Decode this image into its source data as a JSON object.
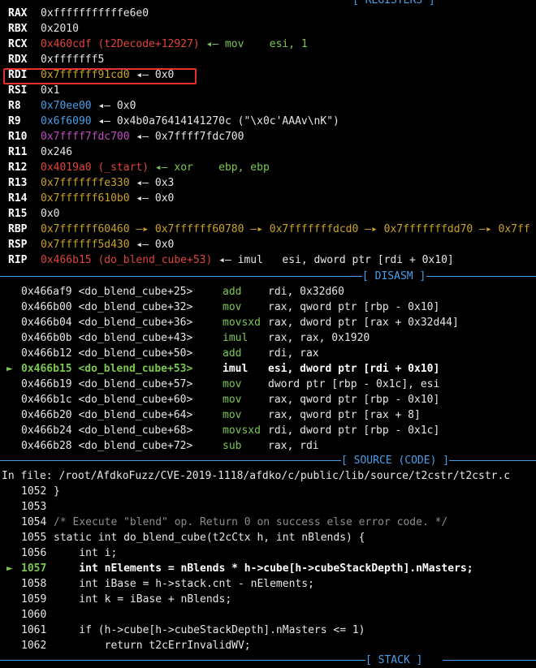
{
  "top_label": "[ REGISTERS ]",
  "registers": [
    {
      "name": "RAX",
      "value": "0xfffffffffffe6e0",
      "color": "w",
      "rest": ""
    },
    {
      "name": "RBX",
      "value": "0x2010",
      "color": "w",
      "rest": ""
    },
    {
      "name": "RCX",
      "value": "0x460cdf (t2Decode+12927)",
      "color": "red",
      "rest": " ◂— mov    esi, 1",
      "rest_color": "grn"
    },
    {
      "name": "RDX",
      "value": "0xfffffff5",
      "color": "w",
      "rest": ""
    },
    {
      "name": "RDI",
      "value": "0x7ffffff91cd0",
      "color": "yel",
      "rest": " ◂— 0x0",
      "rest_color": "w"
    },
    {
      "name": "RSI",
      "value": "0x1",
      "color": "w",
      "rest": ""
    },
    {
      "name": "R8",
      "value": "0x70ee00",
      "color": "blue",
      "rest": " ◂— 0x0",
      "rest_color": "w"
    },
    {
      "name": "R9",
      "value": "0x6f6090",
      "color": "blue",
      "rest": " ◂— 0x4b0a76414141270c (\"\\x0c'AAAv\\nK\")",
      "rest_color": "w"
    },
    {
      "name": "R10",
      "value": "0x7ffff7fdc700",
      "color": "mag",
      "rest": " ◂— 0x7ffff7fdc700",
      "rest_color": "w"
    },
    {
      "name": "R11",
      "value": "0x246",
      "color": "w",
      "rest": ""
    },
    {
      "name": "R12",
      "value": "0x4019a0 (_start)",
      "color": "red",
      "rest": " ◂— xor    ebp, ebp",
      "rest_color": "grn"
    },
    {
      "name": "R13",
      "value": "0x7fffffffe330",
      "color": "yel",
      "rest": " ◂— 0x3",
      "rest_color": "w"
    },
    {
      "name": "R14",
      "value": "0x7ffffff610b0",
      "color": "yel",
      "rest": " ◂— 0x0",
      "rest_color": "w"
    },
    {
      "name": "R15",
      "value": "0x0",
      "color": "w",
      "rest": ""
    },
    {
      "name": "RBP",
      "value": "0x7ffffff60460",
      "color": "yel",
      "rest": " —▸ 0x7ffffff60780 —▸ 0x7fffffffdcd0 —▸ 0x7fffffffdd70 —▸ 0x7ff",
      "rest_color": "yel"
    },
    {
      "name": "RSP",
      "value": "0x7ffffff5d430",
      "color": "yel",
      "rest": " ◂— 0x0",
      "rest_color": "w"
    },
    {
      "name": "RIP",
      "value": "0x466b15 (do_blend_cube+53)",
      "color": "red",
      "rest": " ◂— imul   esi, dword ptr [rdi + 0x10]",
      "rest_color": "w"
    }
  ],
  "disasm_label": "[ DISASM ]",
  "disasm": [
    {
      "addr": "0x466af9 <do_blend_cube+25>",
      "op": "add",
      "args": "rdi, 0x32d60",
      "current": false
    },
    {
      "addr": "0x466b00 <do_blend_cube+32>",
      "op": "mov",
      "args": "rax, qword ptr [rbp - 0x10]",
      "current": false
    },
    {
      "addr": "0x466b04 <do_blend_cube+36>",
      "op": "movsxd",
      "args": "rax, dword ptr [rax + 0x32d44]",
      "current": false
    },
    {
      "addr": "0x466b0b <do_blend_cube+43>",
      "op": "imul",
      "args": "rax, rax, 0x1920",
      "current": false
    },
    {
      "addr": "0x466b12 <do_blend_cube+50>",
      "op": "add",
      "args": "rdi, rax",
      "current": false
    },
    {
      "addr": "0x466b15 <do_blend_cube+53>",
      "op": "imul",
      "args": "esi, dword ptr [rdi + 0x10]",
      "current": true
    },
    {
      "addr": "0x466b19 <do_blend_cube+57>",
      "op": "mov",
      "args": "dword ptr [rbp - 0x1c], esi",
      "current": false
    },
    {
      "addr": "0x466b1c <do_blend_cube+60>",
      "op": "mov",
      "args": "rax, qword ptr [rbp - 0x10]",
      "current": false
    },
    {
      "addr": "0x466b20 <do_blend_cube+64>",
      "op": "mov",
      "args": "rax, qword ptr [rax + 8]",
      "current": false
    },
    {
      "addr": "0x466b24 <do_blend_cube+68>",
      "op": "movsxd",
      "args": "rdi, dword ptr [rbp - 0x1c]",
      "current": false
    },
    {
      "addr": "0x466b28 <do_blend_cube+72>",
      "op": "sub",
      "args": "rax, rdi",
      "current": false
    }
  ],
  "source_label": "[ SOURCE (CODE) ]",
  "file_line": "In file: /root/AfdkoFuzz/CVE-2019-1118/afdko/c/public/lib/source/t2cstr/t2cstr.c",
  "source": [
    {
      "no": "1052",
      "code": "}",
      "current": false
    },
    {
      "no": "1053",
      "code": "",
      "current": false
    },
    {
      "no": "1054",
      "code": "/* Execute \"blend\" op. Return 0 on success else error code. */",
      "current": false,
      "comment": true
    },
    {
      "no": "1055",
      "code": "static int do_blend_cube(t2cCtx h, int nBlends) {",
      "current": false
    },
    {
      "no": "1056",
      "code": "    int i;",
      "current": false
    },
    {
      "no": "1057",
      "code": "    int nElements = nBlends * h->cube[h->cubeStackDepth].nMasters;",
      "current": true
    },
    {
      "no": "1058",
      "code": "    int iBase = h->stack.cnt - nElements;",
      "current": false
    },
    {
      "no": "1059",
      "code": "    int k = iBase + nBlends;",
      "current": false
    },
    {
      "no": "1060",
      "code": "",
      "current": false
    },
    {
      "no": "1061",
      "code": "    if (h->cube[h->cubeStackDepth].nMasters <= 1)",
      "current": false
    },
    {
      "no": "1062",
      "code": "        return t2cErrInvalidWV;",
      "current": false
    }
  ],
  "stack_label": "[ STACK ]",
  "current_marker": "►"
}
